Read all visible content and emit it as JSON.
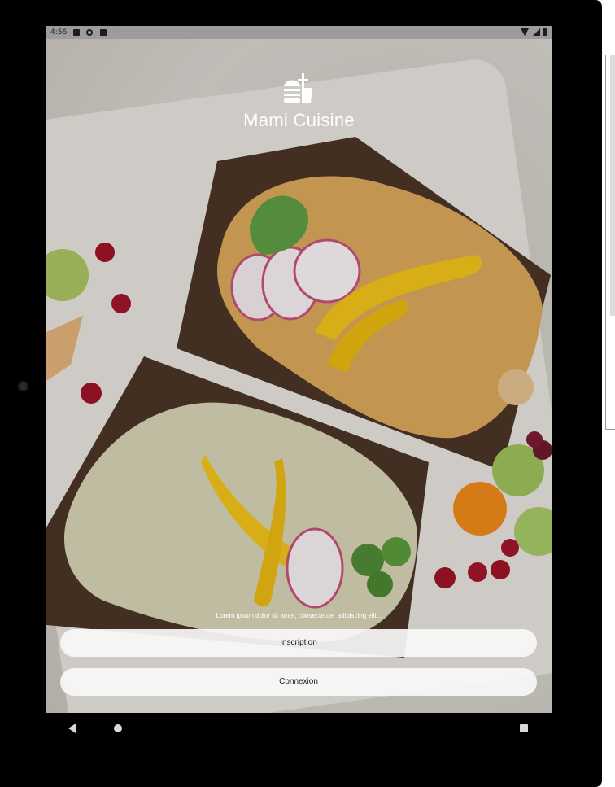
{
  "status_bar": {
    "time": "4:56"
  },
  "app": {
    "title": "Mami Cuisine",
    "logo_icon": "fast-food-icon"
  },
  "tagline": "Lorem ipsum dolor sit amet, consectetuer adipiscing elit...",
  "buttons": {
    "signup": "Inscription",
    "login": "Connexion"
  },
  "nav": {
    "back_icon": "back-triangle-icon",
    "home_icon": "home-circle-icon",
    "recents_icon": "recents-square-icon"
  },
  "colors": {
    "overlay": "#00000019",
    "button_bg": "#f7f7f7",
    "title": "#ffffff"
  }
}
